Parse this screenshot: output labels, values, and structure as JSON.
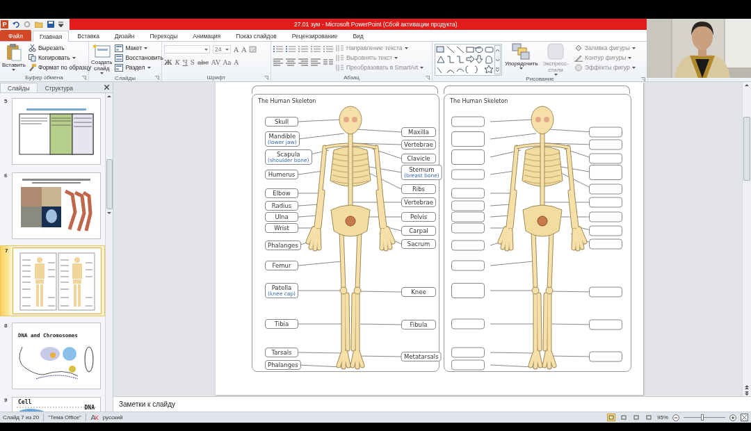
{
  "quick_access": {
    "app_letter": "P"
  },
  "title_bar": {
    "title": "27.01 зум  -  Microsoft PowerPoint (Сбой активации продукта)"
  },
  "tabs": [
    {
      "label": "Файл",
      "kind": "file",
      "selected": false
    },
    {
      "label": "Главная",
      "kind": "tab",
      "selected": true
    },
    {
      "label": "Вставка",
      "kind": "tab",
      "selected": false
    },
    {
      "label": "Дизайн",
      "kind": "tab",
      "selected": false
    },
    {
      "label": "Переходы",
      "kind": "tab",
      "selected": false
    },
    {
      "label": "Анимация",
      "kind": "tab",
      "selected": false
    },
    {
      "label": "Показ слайдов",
      "kind": "tab",
      "selected": false
    },
    {
      "label": "Рецензирование",
      "kind": "tab",
      "selected": false
    },
    {
      "label": "Вид",
      "kind": "tab",
      "selected": false
    }
  ],
  "ribbon_groups": [
    {
      "kind": "clipboard",
      "label": "Буфер обмена",
      "items": [
        {
          "label": "Вставить",
          "kind": "large",
          "dropdown": true,
          "disabled": false
        },
        {
          "label": "Вырезать",
          "kind": "small",
          "dropdown": false,
          "disabled": false
        },
        {
          "label": "Копировать",
          "kind": "small",
          "dropdown": true,
          "disabled": false
        },
        {
          "label": "Формат по образцу",
          "kind": "small",
          "dropdown": false,
          "disabled": false
        }
      ]
    },
    {
      "kind": "slides",
      "label": "Слайды",
      "items": [
        {
          "label": "Создать слайд",
          "kind": "large",
          "dropdown": true,
          "disabled": false
        },
        {
          "label": "Макет",
          "kind": "small",
          "dropdown": true,
          "disabled": false
        },
        {
          "label": "Восстановить",
          "kind": "small",
          "dropdown": false,
          "disabled": false
        },
        {
          "label": "Раздел",
          "kind": "small",
          "dropdown": true,
          "disabled": false
        }
      ]
    },
    {
      "kind": "font",
      "label": "Шрифт",
      "size": "24",
      "size_buttons": [
        "A",
        "A"
      ],
      "format_buttons": [
        "Ж",
        "К",
        "Ч",
        "S",
        "abc",
        "AV",
        "Aa",
        "A"
      ]
    },
    {
      "kind": "paragraph",
      "label": "Абзац",
      "items": [
        {
          "label": "Направление текста",
          "kind": "small",
          "dropdown": true,
          "disabled": true
        },
        {
          "label": "Выровнять текст",
          "kind": "small",
          "dropdown": true,
          "disabled": true
        },
        {
          "label": "Преобразовать в SmartArt",
          "kind": "small",
          "dropdown": true,
          "disabled": true
        }
      ]
    },
    {
      "kind": "drawing",
      "label": "Рисование",
      "items": [
        {
          "label": "Упорядочить",
          "kind": "large",
          "dropdown": true,
          "disabled": false
        },
        {
          "label": "Экспресс-стили",
          "kind": "large",
          "dropdown": true,
          "disabled": true
        },
        {
          "label": "Заливка фигуры",
          "kind": "small",
          "dropdown": true,
          "disabled": true
        },
        {
          "label": "Контур фигуры",
          "kind": "small",
          "dropdown": true,
          "disabled": true
        },
        {
          "label": "Эффекты фигур",
          "kind": "small",
          "dropdown": true,
          "disabled": true
        }
      ]
    }
  ],
  "slide_panel": {
    "tabs": [
      {
        "label": "Слайды",
        "selected": true
      },
      {
        "label": "Структура",
        "selected": false
      }
    ],
    "slides": [
      {
        "number": "5",
        "kind": "table",
        "selected": false
      },
      {
        "number": "6",
        "kind": "photos",
        "selected": false
      },
      {
        "number": "7",
        "kind": "skeleton",
        "selected": true
      },
      {
        "number": "8",
        "kind": "dna",
        "selected": false,
        "texts": [
          "DNA and Chromosomes"
        ]
      },
      {
        "number": "9",
        "kind": "cell",
        "selected": false,
        "texts": [
          "Cell",
          "DNA"
        ]
      }
    ]
  },
  "worksheets": [
    {
      "kind": "labelled",
      "title": "The Human Skeleton",
      "left_labels": [
        {
          "text": "Skull"
        },
        {
          "text": "Mandible",
          "note": "(lower jaw)"
        },
        {
          "text": "Scapula",
          "note": "(shoulder bone)"
        },
        {
          "text": "Humerus"
        },
        {
          "text": "Elbow"
        },
        {
          "text": "Radius"
        },
        {
          "text": "Ulna"
        },
        {
          "text": "Wrist"
        },
        {
          "text": "Phalanges"
        },
        {
          "text": "Femur"
        },
        {
          "text": "Patella",
          "note": "(knee cap)"
        },
        {
          "text": "Tibia"
        },
        {
          "text": "Tarsals"
        },
        {
          "text": "Phalanges"
        }
      ],
      "right_labels": [
        {
          "text": "Maxilla"
        },
        {
          "text": "Vertebrae"
        },
        {
          "text": "Clavicle"
        },
        {
          "text": "Sternum",
          "note": "(breast bone)"
        },
        {
          "text": "Ribs"
        },
        {
          "text": "Vertebrae"
        },
        {
          "text": "Pelvis"
        },
        {
          "text": "Carpal"
        },
        {
          "text": "Sacrum"
        },
        {
          "text": "Knee"
        },
        {
          "text": "Fibula"
        },
        {
          "text": "Metatarsals"
        }
      ]
    },
    {
      "kind": "blank",
      "title": "The Human Skeleton"
    }
  ],
  "notes": {
    "placeholder": "Заметки к слайду"
  },
  "status_bar": {
    "slide": "Слайд 7 из 20",
    "theme": "\"Тема Office\"",
    "language": "русский",
    "views": [
      {
        "selected": true
      },
      {
        "selected": false
      },
      {
        "selected": false
      },
      {
        "selected": false
      }
    ],
    "zoom": "95%",
    "zoom_slider": {
      "level": 0.45
    }
  }
}
